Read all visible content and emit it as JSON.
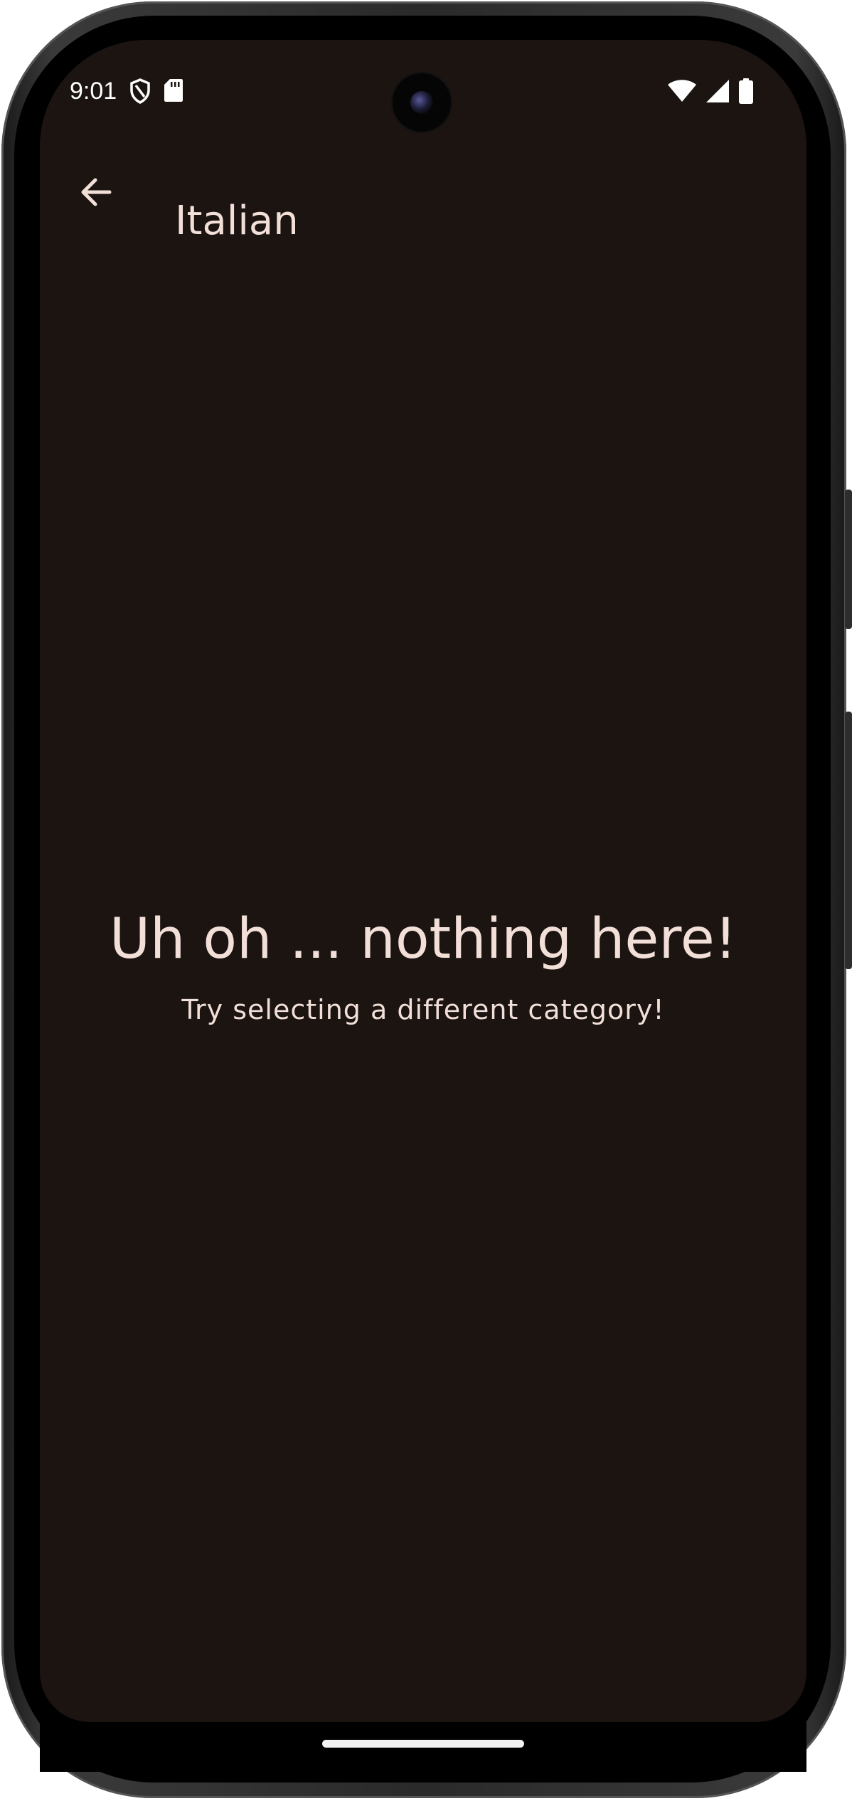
{
  "status_bar": {
    "time": "9:01",
    "left_icons": [
      "shield-icon",
      "sd-card-icon"
    ],
    "right_icons": [
      "wifi-icon",
      "signal-icon",
      "battery-icon"
    ]
  },
  "app_bar": {
    "back_icon": "arrow-back-icon",
    "title": "Italian"
  },
  "empty_state": {
    "heading": "Uh oh ... nothing here!",
    "message": "Try selecting a different category!"
  },
  "colors": {
    "background": "#1b1410",
    "on_background": "#f1dfd8"
  }
}
